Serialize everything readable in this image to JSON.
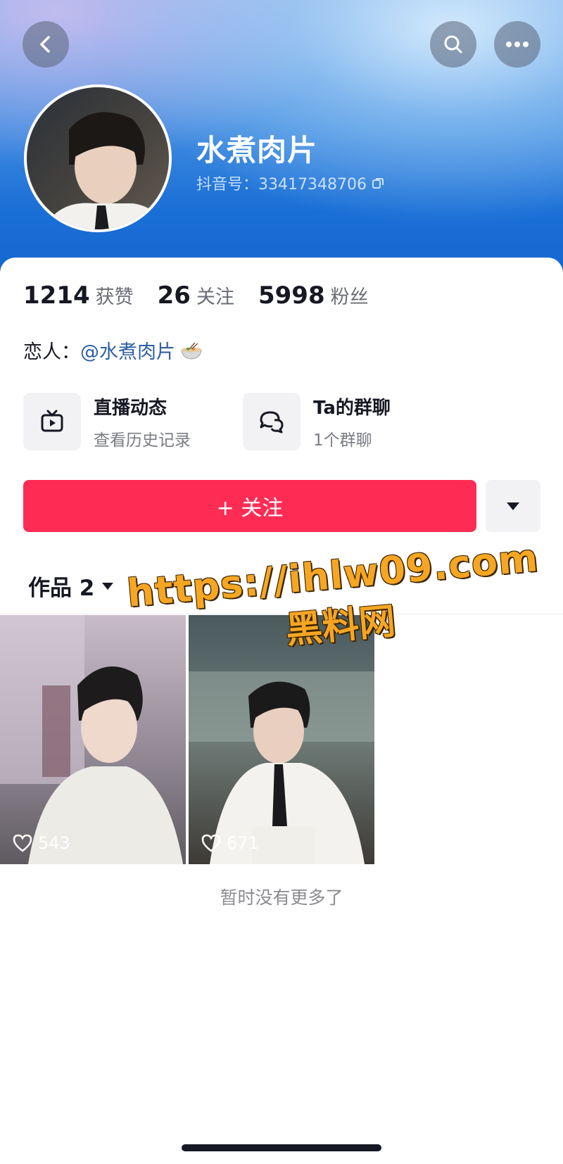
{
  "profile": {
    "nickname": "水煮肉片",
    "douyin_id": "抖音号：33417348706"
  },
  "stats": [
    {
      "value": "1214",
      "label": "获赞"
    },
    {
      "value": "26",
      "label": "关注"
    },
    {
      "value": "5998",
      "label": "粉丝"
    }
  ],
  "lover": {
    "label": "恋人：",
    "link": "@水煮肉片"
  },
  "features": [
    {
      "title": "直播动态",
      "subtitle": "查看历史记录",
      "icon": "tv-icon"
    },
    {
      "title": "Ta的群聊",
      "subtitle": "1个群聊",
      "icon": "chat-bubble-icon"
    }
  ],
  "actions": {
    "follow_label": "+ 关注"
  },
  "works": {
    "tab_label": "作品 2",
    "items": [
      {
        "likes": "543"
      },
      {
        "likes": "671"
      }
    ],
    "end_text": "暂时没有更多了"
  },
  "watermark": {
    "url": "https://ihlw09.com",
    "name": "黑料网"
  },
  "colors": {
    "accent": "#fe2c55",
    "link": "#2f5fa3",
    "watermark": "#f6a623"
  }
}
